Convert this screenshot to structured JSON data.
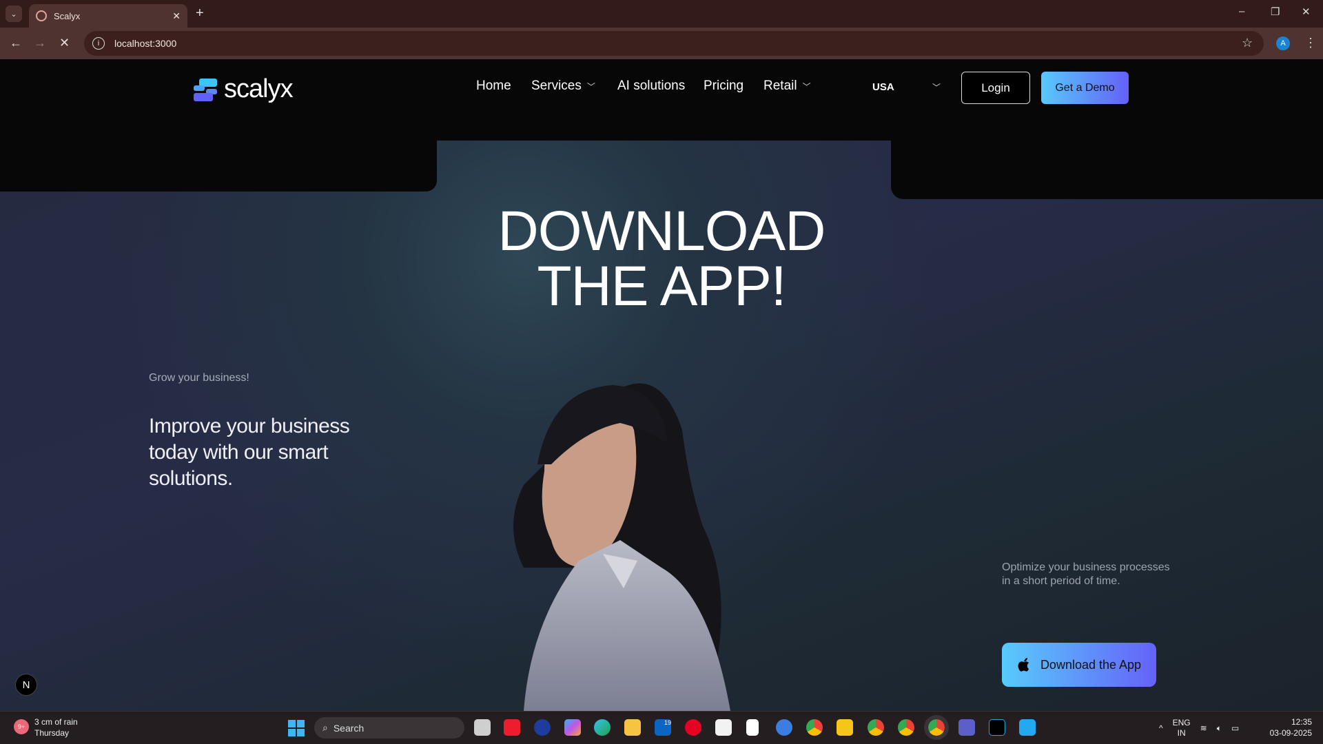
{
  "browser": {
    "tab_title": "Scalyx",
    "url": "localhost:3000",
    "profile_initial": "A"
  },
  "nav": {
    "brand": "scalyx",
    "links": [
      {
        "label": "Home"
      },
      {
        "label": "Services"
      },
      {
        "label": "AI solutions"
      },
      {
        "label": "Pricing"
      },
      {
        "label": "Retail"
      }
    ],
    "country": "USA",
    "login": "Login",
    "demo": "Get a Demo"
  },
  "hero": {
    "title_line1": "DOWNLOAD",
    "title_line2": "THE APP!",
    "eyebrow": "Grow your business!",
    "headline": "Improve your business today with our smart solutions.",
    "right_text": "Optimize your business processes in a short period of time.",
    "download_button": "Download the App",
    "badge": "N"
  },
  "taskbar": {
    "weather_line1": "3 cm of rain",
    "weather_line2": "Thursday",
    "weather_badge": "9+",
    "search": "Search",
    "linkedin_badge": "19",
    "lang1": "ENG",
    "lang2": "IN",
    "time": "12:35",
    "date": "03-09-2025"
  },
  "colors": {
    "accent_start": "#58c9fc",
    "accent_end": "#6460f8"
  }
}
